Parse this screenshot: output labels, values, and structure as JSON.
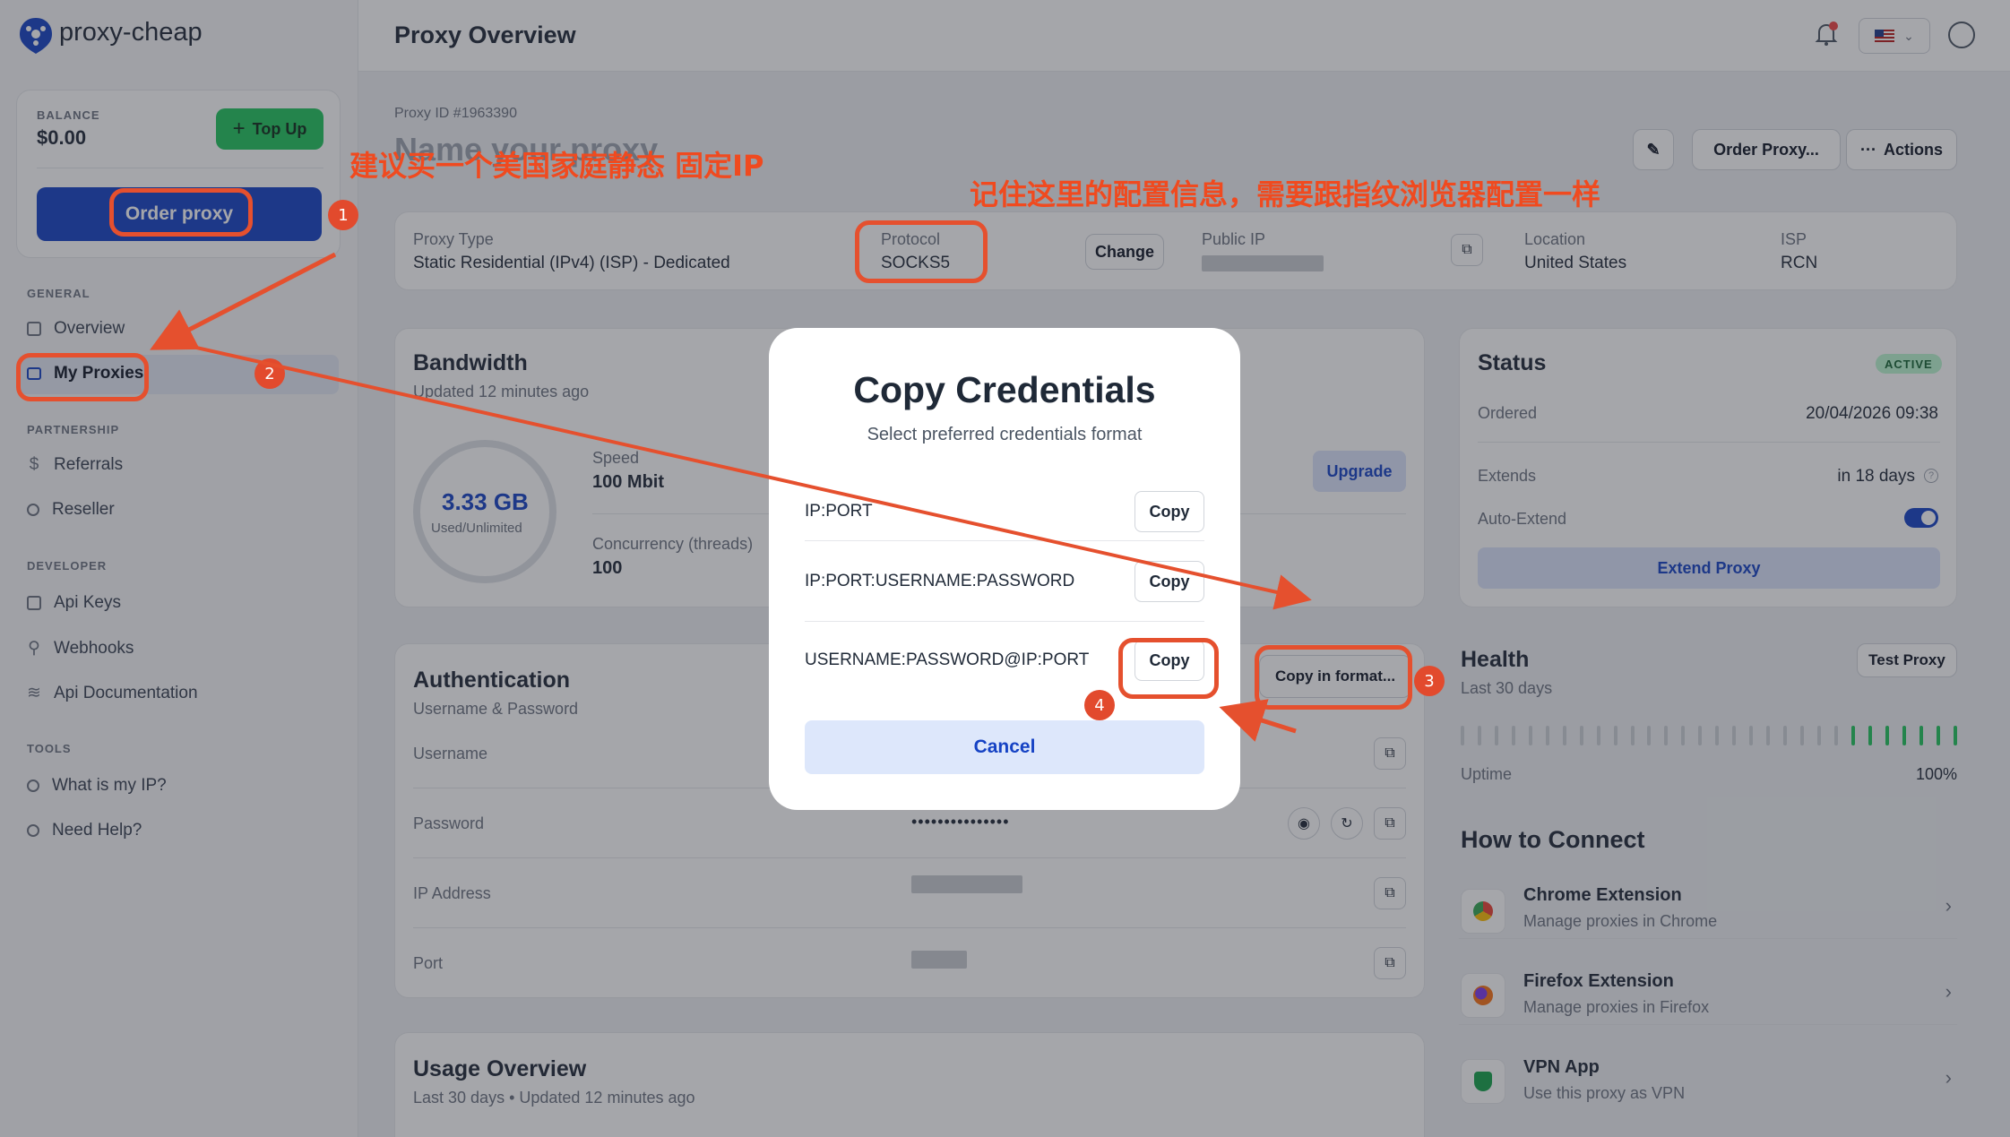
{
  "brand": {
    "name": "proxy-cheap"
  },
  "header": {
    "title": "Proxy Overview",
    "locale": "US flag"
  },
  "sidebar": {
    "balance_label": "BALANCE",
    "balance": "$0.00",
    "topup": "Top Up",
    "order": "Order proxy",
    "sections": {
      "general": "GENERAL",
      "partnership": "PARTNERSHIP",
      "developer": "DEVELOPER",
      "tools": "TOOLS"
    },
    "items": {
      "overview": "Overview",
      "my_proxies": "My Proxies",
      "referrals": "Referrals",
      "reseller": "Reseller",
      "api_keys": "Api Keys",
      "webhooks": "Webhooks",
      "api_docs": "Api Documentation",
      "what_ip": "What is my IP?",
      "help": "Need Help?"
    }
  },
  "proxy": {
    "id": "Proxy ID #1963390",
    "name": "Name your proxy",
    "order_btn": "Order Proxy...",
    "actions_btn": "Actions",
    "type_label": "Proxy Type",
    "type": "Static Residential (IPv4) (ISP) - Dedicated",
    "protocol_label": "Protocol",
    "protocol": "SOCKS5",
    "change": "Change",
    "public_ip_label": "Public IP",
    "location_label": "Location",
    "location": "United States",
    "isp_label": "ISP",
    "isp": "RCN"
  },
  "bandwidth": {
    "title": "Bandwidth",
    "updated": "Updated 12 minutes ago",
    "amount": "3.33 GB",
    "sub": "Used/Unlimited",
    "speed_label": "Speed",
    "speed": "100 Mbit",
    "conc_label": "Concurrency (threads)",
    "conc": "100",
    "upgrade": "Upgrade"
  },
  "status": {
    "title": "Status",
    "badge": "ACTIVE",
    "ordered_label": "Ordered",
    "ordered": "20/04/2026 09:38",
    "extends_label": "Extends",
    "extends": "in 18 days",
    "auto_label": "Auto-Extend",
    "auto_extend_on": true,
    "extend_btn": "Extend Proxy"
  },
  "auth": {
    "title": "Authentication",
    "sub": "Username & Password",
    "username": "Username",
    "password": "Password",
    "password_mask": "•••••••••••••••",
    "ip": "IP Address",
    "port": "Port",
    "copy_format": "Copy in format..."
  },
  "health": {
    "title": "Health",
    "sub": "Last 30 days",
    "test": "Test Proxy",
    "uptime_label": "Uptime",
    "uptime": "100%",
    "days_up": 7,
    "days_total": 30
  },
  "connect": {
    "title": "How to Connect",
    "items": [
      {
        "name": "Chrome Extension",
        "desc": "Manage proxies in Chrome"
      },
      {
        "name": "Firefox Extension",
        "desc": "Manage proxies in Firefox"
      },
      {
        "name": "VPN App",
        "desc": "Use this proxy as VPN"
      }
    ]
  },
  "usage": {
    "title": "Usage Overview",
    "sub": "Last 30 days • Updated 12 minutes ago"
  },
  "modal": {
    "title": "Copy Credentials",
    "sub": "Select preferred credentials format",
    "rows": [
      {
        "format": "IP:PORT",
        "btn": "Copy"
      },
      {
        "format": "IP:PORT:USERNAME:PASSWORD",
        "btn": "Copy"
      },
      {
        "format": "USERNAME:PASSWORD@IP:PORT",
        "btn": "Copy"
      }
    ],
    "cancel": "Cancel"
  },
  "annotations": {
    "a1": "建议买一个美国家庭静态 固定IP",
    "a2": "记住这里的配置信息，需要跟指纹浏览器配置一样",
    "n1": "1",
    "n2": "2",
    "n3": "3",
    "n4": "4"
  },
  "colors": {
    "primary": "#1542c4",
    "green": "#22c55e",
    "annotation": "#e5502e"
  }
}
